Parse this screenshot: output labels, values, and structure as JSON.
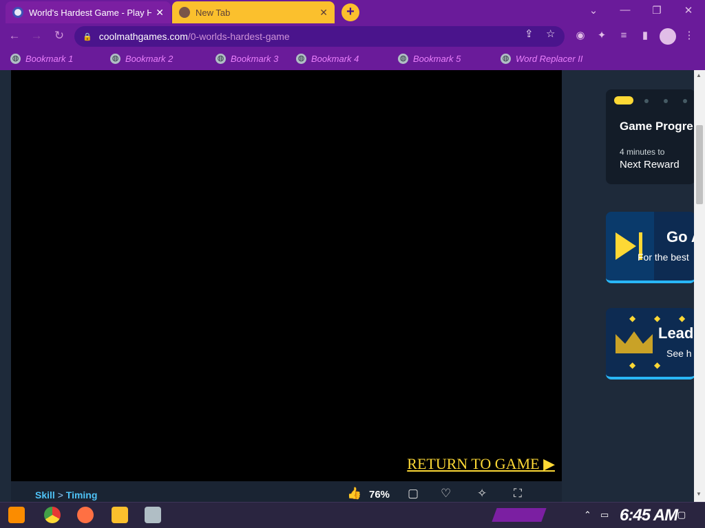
{
  "browser": {
    "tabs": [
      {
        "title": "World's Hardest Game - Play H",
        "active": true
      },
      {
        "title": "New Tab",
        "active": false
      }
    ],
    "new_tab_label": "+",
    "url": {
      "host": "coolmathgames.com",
      "path": "/0-worlds-hardest-game"
    },
    "window_controls": [
      "⌄",
      "—",
      "❐",
      "✕"
    ],
    "bookmarks": [
      "Bookmark 1",
      "Bookmark 2",
      "Bookmark 3",
      "Bookmark 4",
      "Bookmark 5",
      "Word Replacer II"
    ]
  },
  "game": {
    "return_link": "RETURN TO GAME ▶",
    "breadcrumb": {
      "parent": "Skill",
      "separator": ">",
      "current": "Timing"
    },
    "rating": "76%"
  },
  "sidebar": {
    "progress": {
      "title": "Game Progre",
      "subtitle": "4 minutes to",
      "reward": "Next Reward"
    },
    "go_ad": {
      "title": "Go A",
      "subtitle": "For the best"
    },
    "leaderboard": {
      "title": "Lead",
      "subtitle": "See h"
    }
  },
  "taskbar": {
    "clock": "6:45 AM"
  },
  "colors": {
    "chrome": "#6a1b9a",
    "tab_active": "#7b1fa2",
    "tab_inactive": "#fbc02d",
    "accent_yellow": "#fdd835",
    "page_bg": "#1e2a3a"
  }
}
